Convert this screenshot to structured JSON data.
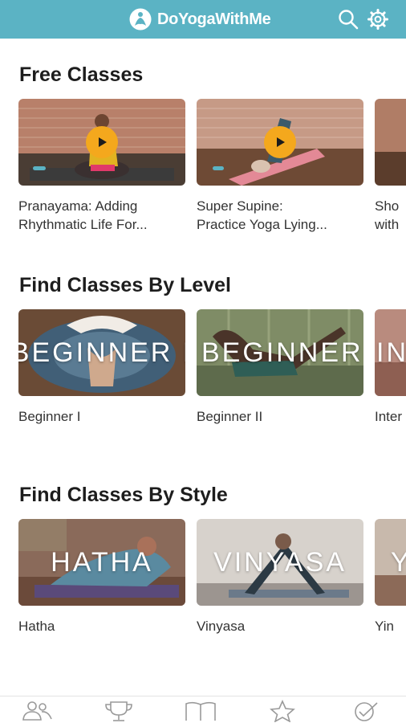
{
  "app": {
    "name": "DoYogaWithMe"
  },
  "header": {
    "logo_icon": "lotus-logo-icon",
    "search_icon": "search-icon",
    "settings_icon": "gear-icon",
    "background": "#5bb3c4"
  },
  "sections": [
    {
      "title": "Free Classes",
      "cards": [
        {
          "title_line1": "Pranayama: Adding",
          "title_line2": "Rhythmatic Life For...",
          "overlay": "",
          "progress": 0.08
        },
        {
          "title_line1": "Super Supine:",
          "title_line2": "Practice Yoga Lying...",
          "overlay": "",
          "progress": 0.07
        },
        {
          "title_line1": "Sho",
          "title_line2": "with",
          "overlay": ""
        }
      ]
    },
    {
      "title": "Find Classes By Level",
      "cards": [
        {
          "title_line1": "Beginner I",
          "overlay": "BEGINNER I"
        },
        {
          "title_line1": "Beginner II",
          "overlay": "BEGINNER II"
        },
        {
          "title_line1": "Inter",
          "overlay": "INT"
        }
      ]
    },
    {
      "title": "Find Classes By Style",
      "cards": [
        {
          "title_line1": "Hatha",
          "overlay": "HATHA"
        },
        {
          "title_line1": "Vinyasa",
          "overlay": "VINYASA"
        },
        {
          "title_line1": "Yin",
          "overlay": "Y"
        }
      ]
    }
  ],
  "tabbar": {
    "items": [
      "community-icon",
      "trophy-icon",
      "book-icon",
      "star-icon",
      "check-circle-icon"
    ],
    "color": "#9a9a9a"
  }
}
